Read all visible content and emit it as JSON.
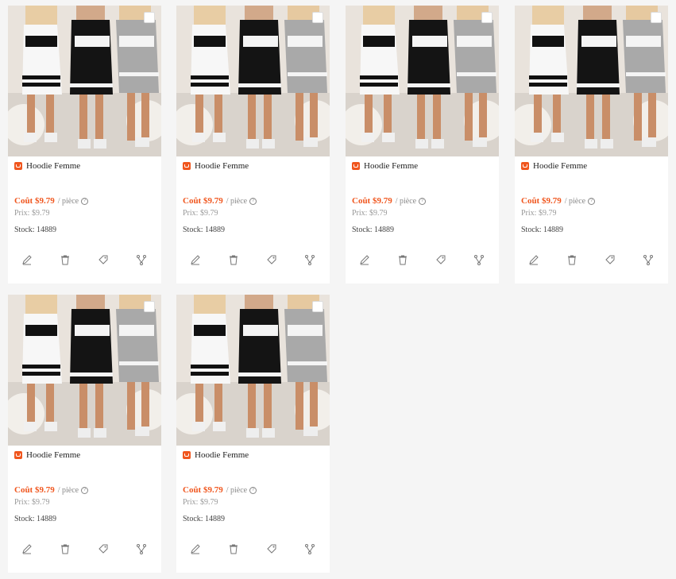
{
  "products": [
    {
      "title": "Hoodie Femme",
      "cost": "Coût $9.79",
      "per_unit": "/ pièce",
      "price": "Prix: $9.79",
      "stock": "Stock: 14889"
    },
    {
      "title": "Hoodie Femme",
      "cost": "Coût $9.79",
      "per_unit": "/ pièce",
      "price": "Prix: $9.79",
      "stock": "Stock: 14889"
    },
    {
      "title": "Hoodie Femme",
      "cost": "Coût $9.79",
      "per_unit": "/ pièce",
      "price": "Prix: $9.79",
      "stock": "Stock: 14889"
    },
    {
      "title": "Hoodie Femme",
      "cost": "Coût $9.79",
      "per_unit": "/ pièce",
      "price": "Prix: $9.79",
      "stock": "Stock: 14889"
    },
    {
      "title": "Hoodie Femme",
      "cost": "Coût $9.79",
      "per_unit": "/ pièce",
      "price": "Prix: $9.79",
      "stock": "Stock: 14889"
    },
    {
      "title": "Hoodie Femme",
      "cost": "Coût $9.79",
      "per_unit": "/ pièce",
      "price": "Prix: $9.79",
      "stock": "Stock: 14889"
    }
  ],
  "colors": {
    "accent": "#f0561e",
    "card_bg": "#ffffff",
    "page_bg": "#f5f5f5"
  },
  "icons": {
    "store": "store-icon",
    "help": "question-circle-icon",
    "edit": "pencil-icon",
    "delete": "trash-icon",
    "tag": "tag-icon",
    "variants": "fork-icon"
  }
}
